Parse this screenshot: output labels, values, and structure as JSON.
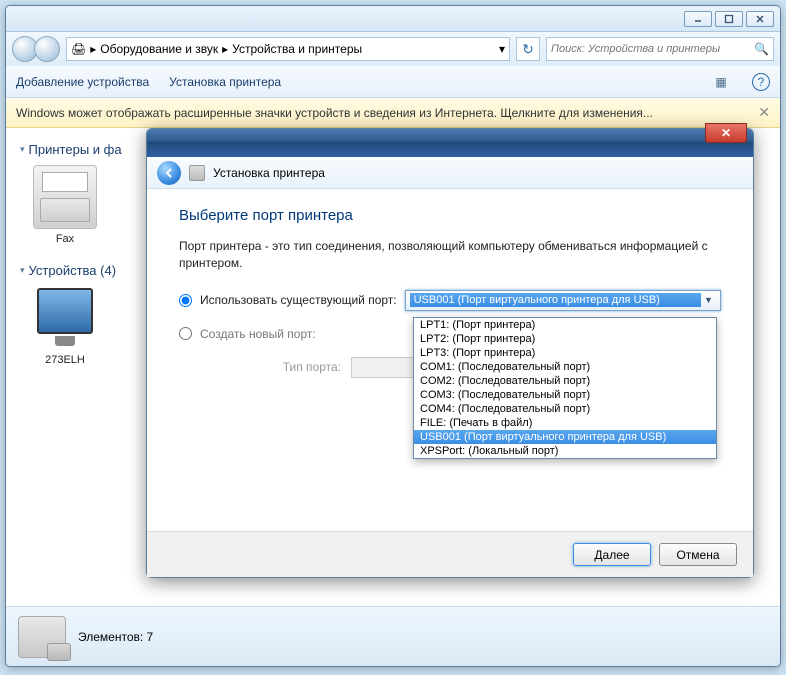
{
  "breadcrumbs": {
    "seg1": "Оборудование и звук",
    "seg2": "Устройства и принтеры"
  },
  "search": {
    "placeholder": "Поиск: Устройства и принтеры"
  },
  "toolbar": {
    "add_device": "Добавление устройства",
    "add_printer": "Установка принтера"
  },
  "infobar": {
    "text": "Windows может отображать расширенные значки устройств и сведения из Интернета.  Щелкните для изменения..."
  },
  "groups": {
    "printers": {
      "title": "Принтеры и фа"
    },
    "devices": {
      "title": "Устройства (4)"
    }
  },
  "items": {
    "fax": "Fax",
    "monitor": "273ELH"
  },
  "statusbar": {
    "count_label": "Элементов: 7"
  },
  "dialog": {
    "header_label": "Установка принтера",
    "title": "Выберите порт принтера",
    "desc": "Порт принтера - это тип соединения, позволяющий компьютеру обмениваться информацией с принтером.",
    "radio_existing": "Использовать существующий порт:",
    "radio_new": "Создать новый порт:",
    "port_type_label": "Тип порта:",
    "combo_selected": "USB001 (Порт виртуального принтера для USB)",
    "next": "Далее",
    "cancel": "Отмена",
    "ports": [
      "LPT1: (Порт принтера)",
      "LPT2: (Порт принтера)",
      "LPT3: (Порт принтера)",
      "COM1: (Последовательный порт)",
      "COM2: (Последовательный порт)",
      "COM3: (Последовательный порт)",
      "COM4: (Последовательный порт)",
      "FILE: (Печать в файл)",
      "USB001 (Порт виртуального принтера для USB)",
      "XPSPort: (Локальный порт)"
    ],
    "selected_index": 8
  }
}
